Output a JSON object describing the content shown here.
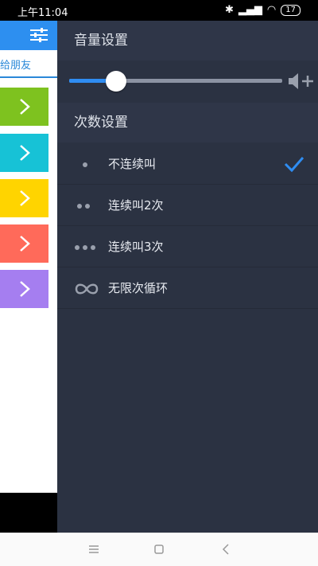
{
  "status_bar": {
    "time": "上午11:04",
    "battery": "17"
  },
  "left_panel": {
    "share_text": "给朋友",
    "cards": [
      {
        "color": "#7ec21f"
      },
      {
        "color": "#17c2d6"
      },
      {
        "color": "#ffd400"
      },
      {
        "color": "#ff6a5a"
      },
      {
        "color": "#a57ef0"
      }
    ]
  },
  "drawer": {
    "volume_title": "音量设置",
    "volume_level": 0.22,
    "repeat_title": "次数设置",
    "options": [
      {
        "label": "不连续叫",
        "dots": 1,
        "selected": true
      },
      {
        "label": "连续叫2次",
        "dots": 2,
        "selected": false
      },
      {
        "label": "连续叫3次",
        "dots": 3,
        "selected": false
      },
      {
        "label": "无限次循环",
        "dots": 0,
        "infinite": true,
        "selected": false
      }
    ]
  },
  "colors": {
    "accent": "#2f8df2",
    "drawer_bg": "#2b3242",
    "header_bg": "#2f3648"
  }
}
